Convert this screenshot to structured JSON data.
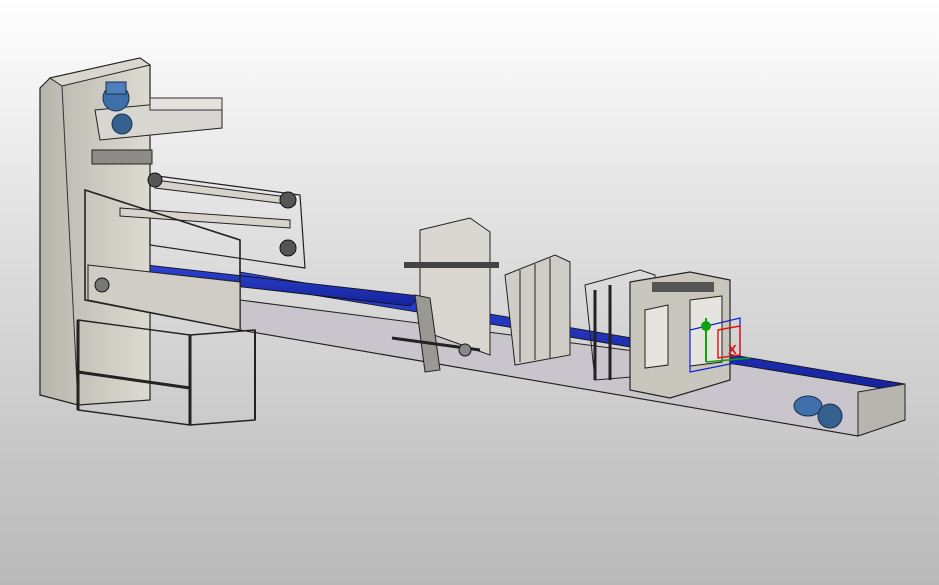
{
  "app": {
    "view": "3d-cad-viewport"
  },
  "model": {
    "belt_color": "#1a2fb8",
    "frame_color": "#cfcdc6",
    "frame_dark": "#9c9a94",
    "motor_color": "#3f6fa8",
    "edge_color": "#222222",
    "body_color": "#c9c6bd"
  },
  "triad": {
    "x_label": "X",
    "x_color": "#e01010",
    "y_color": "#10a010",
    "z_color": "#1020d0"
  },
  "icons": [
    "drive-motor-icon",
    "coordinate-triad-icon"
  ]
}
